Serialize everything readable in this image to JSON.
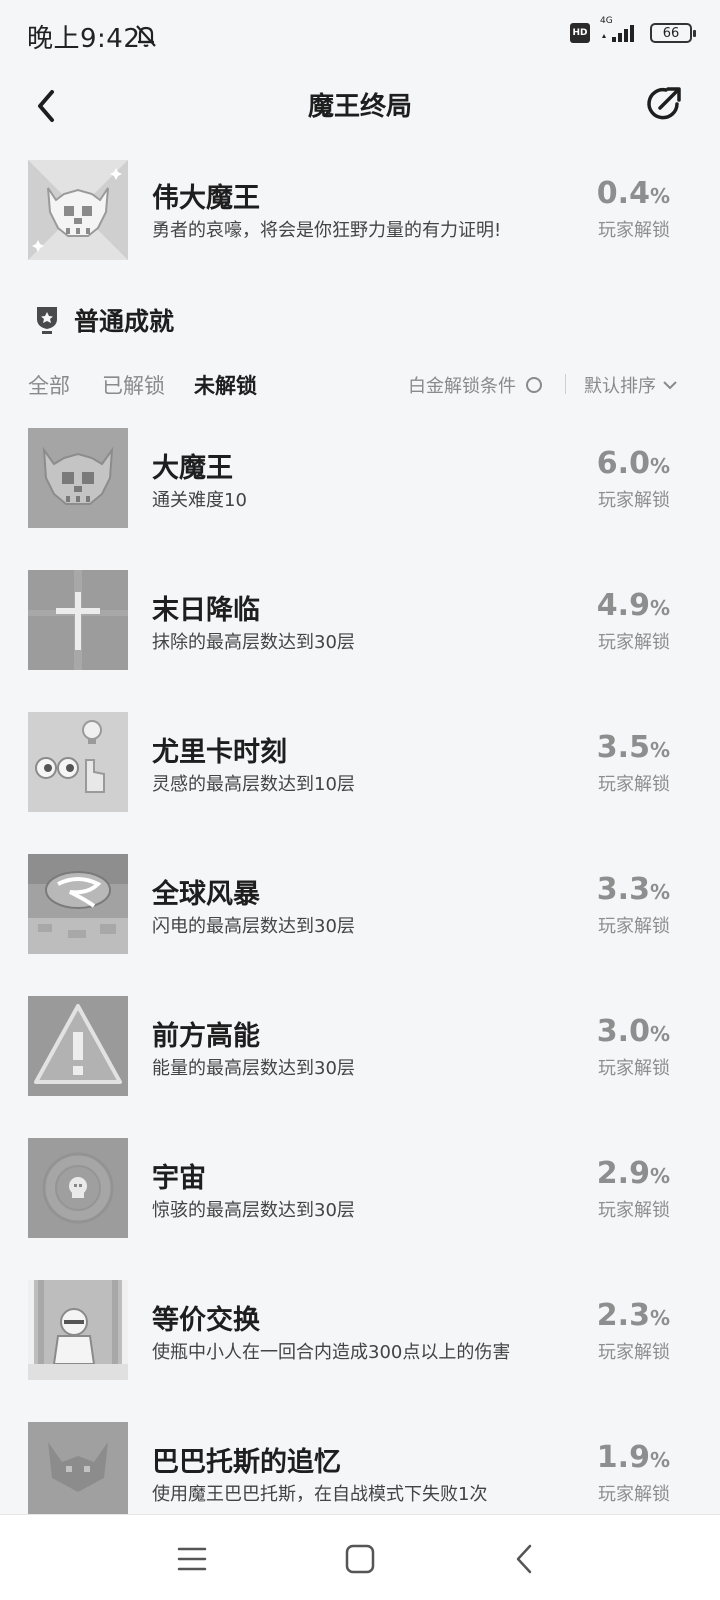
{
  "status_bar": {
    "time": "晚上9:42",
    "network": "4G",
    "hd_label": "HD",
    "battery": "66"
  },
  "header": {
    "title": "魔王终局"
  },
  "featured": {
    "title": "伟大魔王",
    "desc": "勇者的哀嚎，将会是你狂野力量的有力证明!",
    "pct": "0.4",
    "pct_unit": "%",
    "sub": "玩家解锁"
  },
  "section": {
    "title": "普通成就"
  },
  "filters": {
    "tabs": [
      "全部",
      "已解锁",
      "未解锁"
    ],
    "active_tab": "未解锁",
    "platinum": "白金解锁条件",
    "sort": "默认排序"
  },
  "achievements": [
    {
      "title": "大魔王",
      "desc": "通关难度10",
      "pct": "6.0",
      "pct_unit": "%",
      "sub": "玩家解锁",
      "icon": "skull-horns-icon"
    },
    {
      "title": "末日降临",
      "desc": "抹除的最高层数达到30层",
      "pct": "4.9",
      "pct_unit": "%",
      "sub": "玩家解锁",
      "icon": "cross-icon"
    },
    {
      "title": "尤里卡时刻",
      "desc": "灵感的最高层数达到10层",
      "pct": "3.5",
      "pct_unit": "%",
      "sub": "玩家解锁",
      "icon": "lightbulb-eyes-icon"
    },
    {
      "title": "全球风暴",
      "desc": "闪电的最高层数达到30层",
      "pct": "3.3",
      "pct_unit": "%",
      "sub": "玩家解锁",
      "icon": "storm-icon"
    },
    {
      "title": "前方高能",
      "desc": "能量的最高层数达到30层",
      "pct": "3.0",
      "pct_unit": "%",
      "sub": "玩家解锁",
      "icon": "warning-icon"
    },
    {
      "title": "宇宙",
      "desc": "惊骇的最高层数达到30层",
      "pct": "2.9",
      "pct_unit": "%",
      "sub": "玩家解锁",
      "icon": "cosmos-skull-icon"
    },
    {
      "title": "等价交换",
      "desc": "使瓶中小人在一回合内造成300点以上的伤害",
      "pct": "2.3",
      "pct_unit": "%",
      "sub": "玩家解锁",
      "icon": "bottle-figure-icon"
    },
    {
      "title": "巴巴托斯的追忆",
      "desc": "使用魔王巴巴托斯，在自战模式下失败1次",
      "pct": "1.9",
      "pct_unit": "%",
      "sub": "玩家解锁",
      "icon": "demon-icon"
    }
  ]
}
